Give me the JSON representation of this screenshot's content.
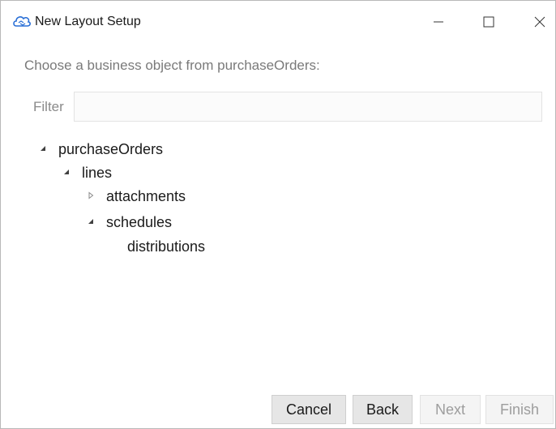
{
  "window": {
    "title": "New Layout Setup",
    "icon": "cloud-sync-icon",
    "controls": {
      "minimize_icon": "minimize-icon",
      "maximize_icon": "maximize-icon",
      "close_icon": "close-icon"
    }
  },
  "prompt": "Choose a business object from purchaseOrders:",
  "filter": {
    "label": "Filter",
    "value": "",
    "placeholder": ""
  },
  "tree": {
    "nodes": [
      {
        "label": "purchaseOrders",
        "state": "expanded"
      },
      {
        "label": "lines",
        "state": "expanded"
      },
      {
        "label": "attachments",
        "state": "collapsed"
      },
      {
        "label": "schedules",
        "state": "expanded"
      },
      {
        "label": "distributions",
        "state": "leaf"
      }
    ]
  },
  "buttons": {
    "cancel": "Cancel",
    "back": "Back",
    "next": "Next",
    "finish": "Finish"
  },
  "colors": {
    "icon_accent": "#2a6fd6",
    "disabled_text": "#9d9d9d"
  }
}
